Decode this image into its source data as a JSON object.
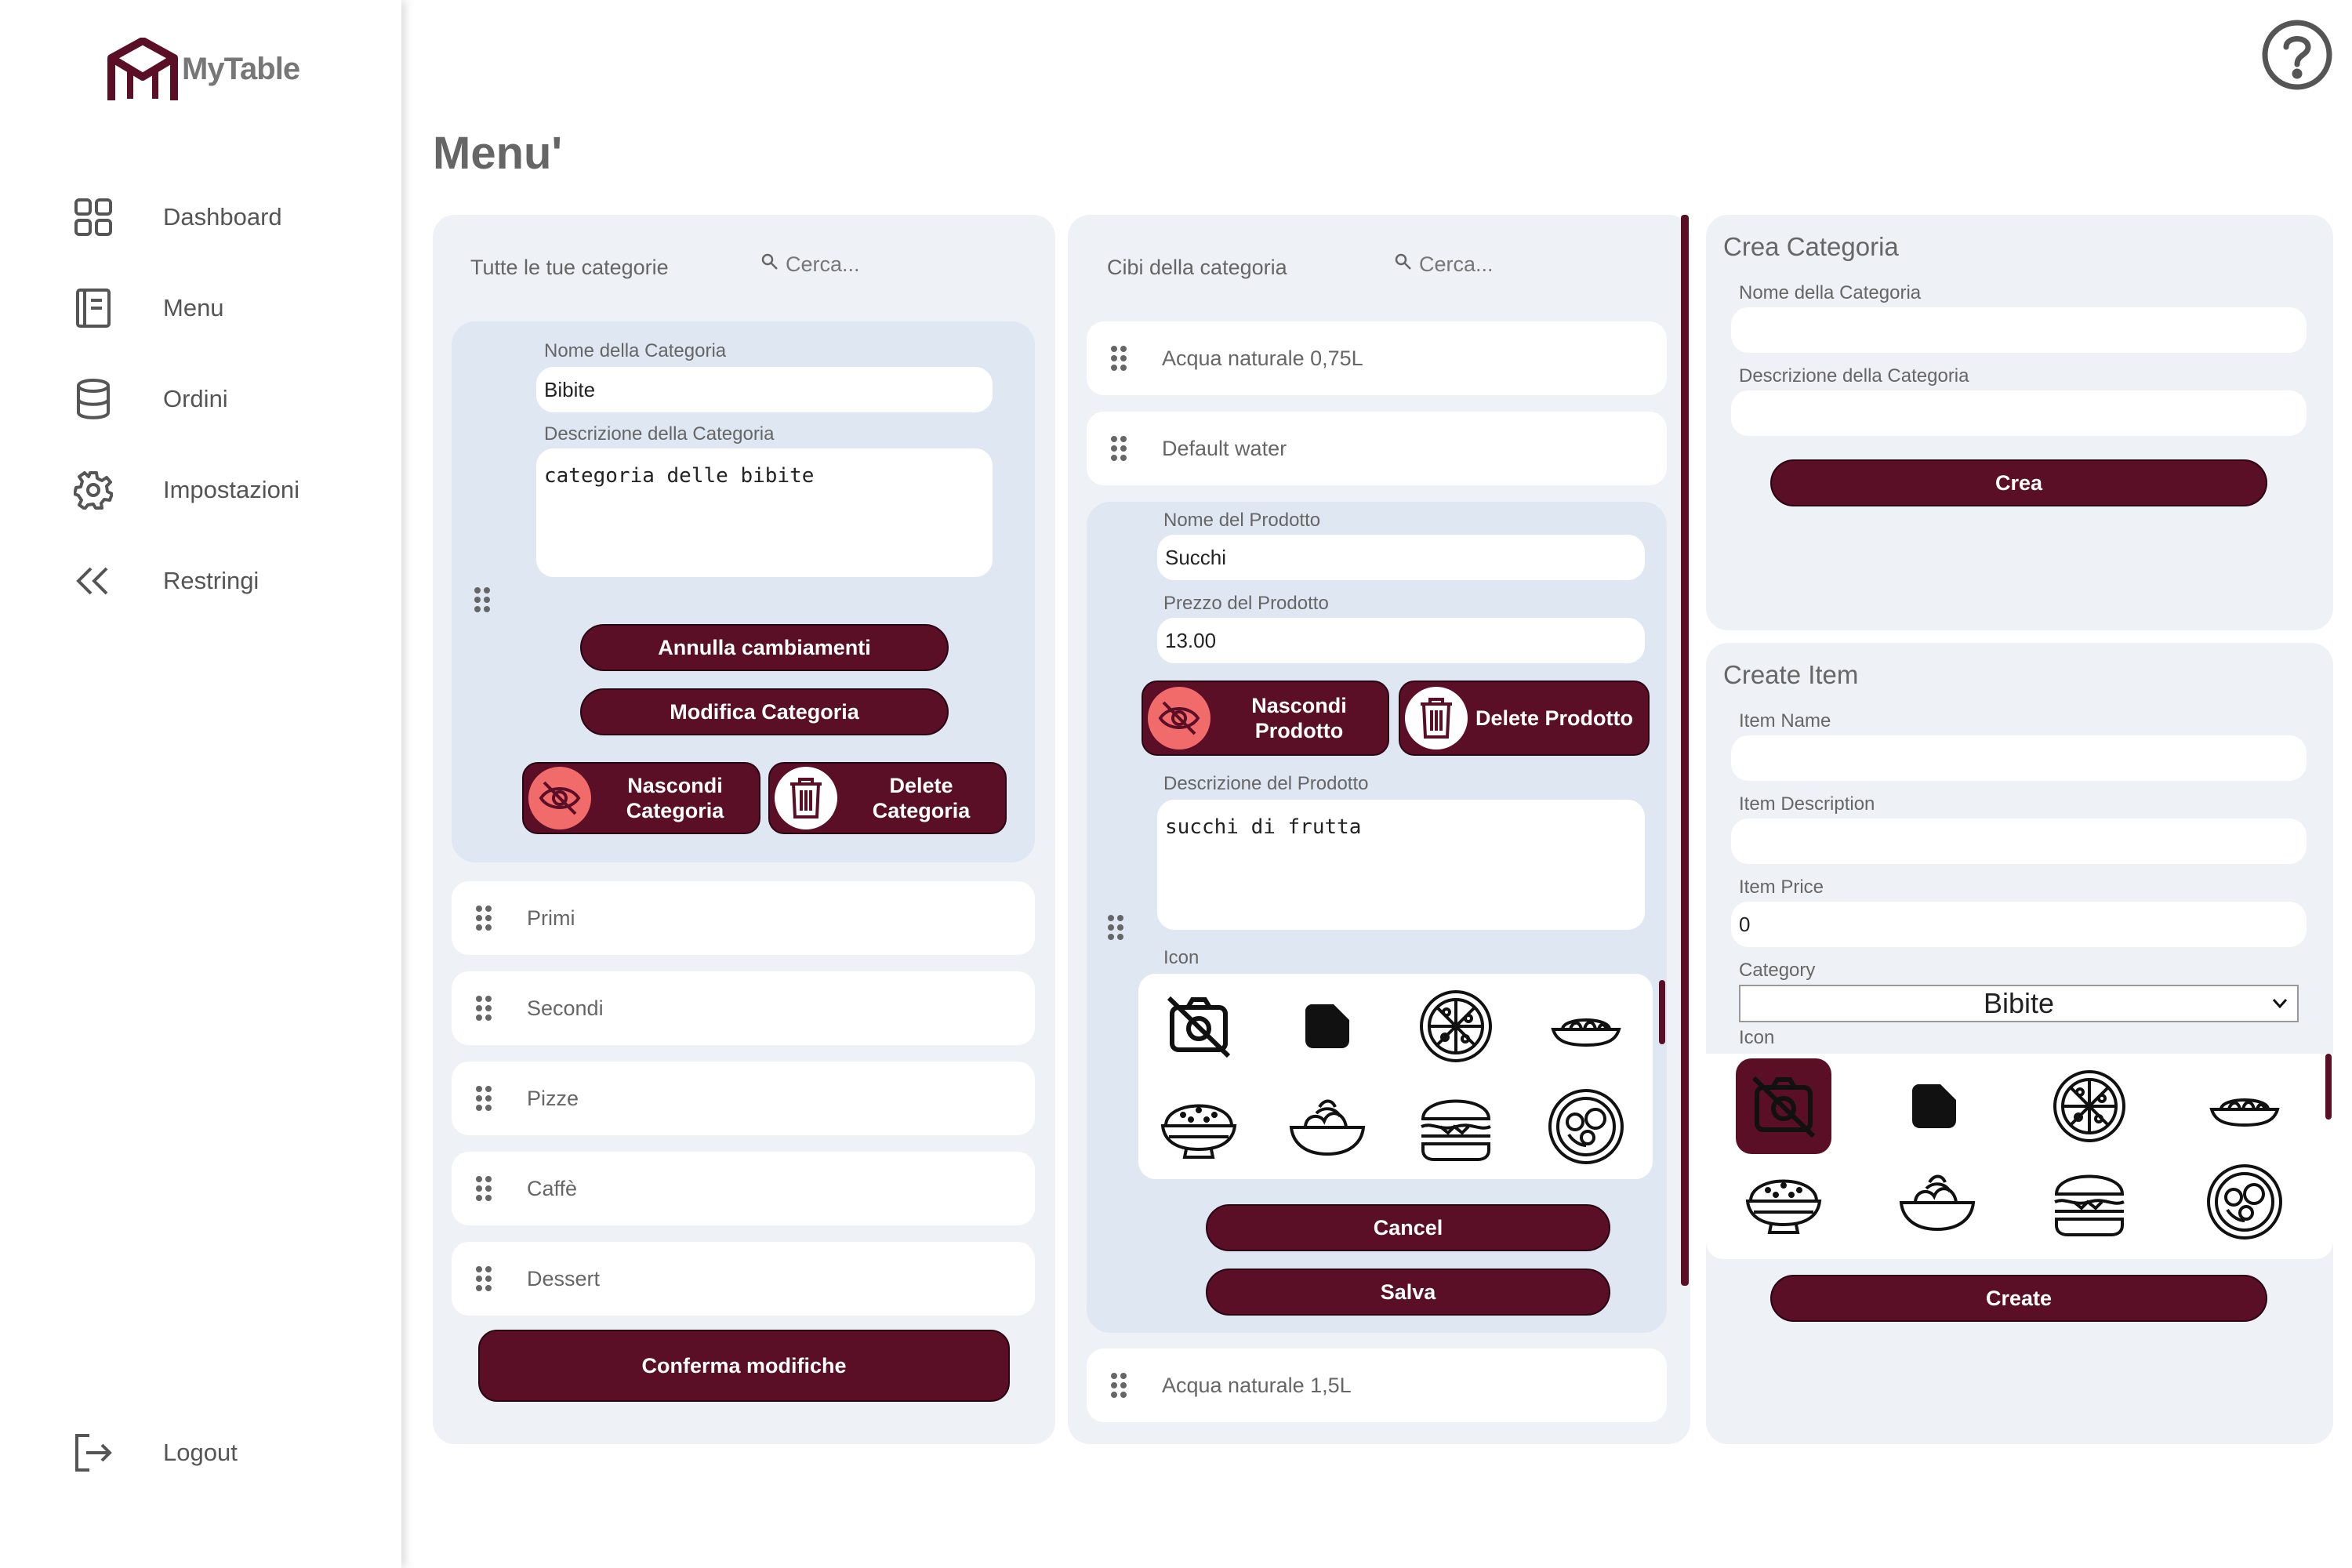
{
  "app": {
    "name": "MyTable",
    "brand_color": "#5a0f27",
    "accent_color": "#f26b6b"
  },
  "sidebar": {
    "items": [
      {
        "label": "Dashboard",
        "icon": "dashboard-grid-icon"
      },
      {
        "label": "Menu",
        "icon": "menu-book-icon"
      },
      {
        "label": "Ordini",
        "icon": "database-icon"
      },
      {
        "label": "Impostazioni",
        "icon": "gear-icon"
      },
      {
        "label": "Restringi",
        "icon": "double-chevron-left-icon"
      }
    ],
    "logout": "Logout"
  },
  "page": {
    "title": "Menu'"
  },
  "categories_panel": {
    "title": "Tutte le tue categorie",
    "search_placeholder": "Cerca...",
    "edit": {
      "name_label": "Nome della Categoria",
      "name_value": "Bibite",
      "desc_label": "Descrizione della Categoria",
      "desc_value": "categoria delle bibite",
      "cancel_label": "Annulla cambiamenti",
      "modify_label": "Modifica Categoria",
      "hide_label_1": "Nascondi",
      "hide_label_2": "Categoria",
      "delete_label_1": "Delete",
      "delete_label_2": "Categoria"
    },
    "items": [
      "Primi",
      "Secondi",
      "Pizze",
      "Caffè",
      "Dessert"
    ],
    "confirm_label": "Conferma modifiche"
  },
  "foods_panel": {
    "title": "Cibi della categoria",
    "search_placeholder": "Cerca...",
    "items_top": [
      "Acqua naturale 0,75L",
      "Default water"
    ],
    "edit": {
      "name_label": "Nome del Prodotto",
      "name_value": "Succhi",
      "price_label": "Prezzo del Prodotto",
      "price_value": "13.00",
      "hide_label_1": "Nascondi",
      "hide_label_2": "Prodotto",
      "delete_label": "Delete Prodotto",
      "desc_label": "Descrizione del Prodotto",
      "desc_value": "succhi di frutta",
      "icon_label": "Icon",
      "cancel_label": "Cancel",
      "save_label": "Salva"
    },
    "items_bottom": [
      "Acqua naturale 1,5L"
    ]
  },
  "create_category": {
    "title": "Crea Categoria",
    "name_label": "Nome della Categoria",
    "name_value": "",
    "desc_label": "Descrizione della Categoria",
    "desc_value": "",
    "button_label": "Crea"
  },
  "create_item": {
    "title": "Create Item",
    "name_label": "Item Name",
    "name_value": "",
    "desc_label": "Item Description",
    "desc_value": "",
    "price_label": "Item Price",
    "price_value": "0",
    "category_label": "Category",
    "category_value": "Bibite",
    "icon_label": "Icon",
    "button_label": "Create"
  },
  "food_icons": [
    "no-image-icon",
    "blob-shape-icon",
    "pizza-icon",
    "pasta-plate-icon",
    "rice-bowl-icon",
    "noodle-bowl-icon",
    "burger-icon",
    "salad-plate-icon"
  ]
}
